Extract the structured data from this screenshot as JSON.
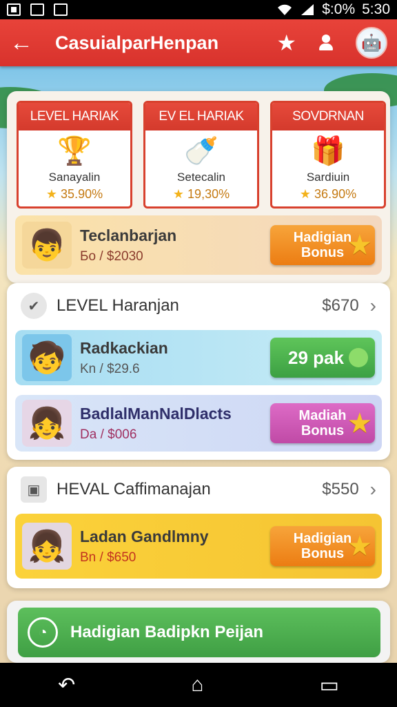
{
  "status": {
    "battery": "$:0%",
    "time": "5:30"
  },
  "appbar": {
    "title": "CasuialparHenpan"
  },
  "levels": [
    {
      "header": "LEVEL HARIAK",
      "name": "Sanayalin",
      "pct": "35.90%",
      "emoji": "🏆"
    },
    {
      "header": "EV EL HARIAK",
      "name": "Setecalin",
      "pct": "19,30%",
      "emoji": "🍼"
    },
    {
      "header": "SOVDRNAN",
      "name": "Sardiuin",
      "pct": "36.90%",
      "emoji": "🎁"
    }
  ],
  "featured": {
    "name": "Teclanbarjan",
    "sub": "Бo / $2030",
    "btn": [
      "Hadigian",
      "Bonus"
    ]
  },
  "section1": {
    "title": "LEVEL Haranjan",
    "price": "$670"
  },
  "rows1": [
    {
      "name": "Radkackian",
      "sub": "Kn / $29.6",
      "btn": "29 pak"
    },
    {
      "name": "BadlalManNalDlacts",
      "sub": "Da / $006",
      "btn": [
        "Madiah",
        "Bonus"
      ]
    }
  ],
  "section2": {
    "title": "HEVAL Caffimanajan",
    "price": "$550"
  },
  "rows2": [
    {
      "name": "Ladan Gandlmny",
      "sub": "Bn / $650",
      "btn": [
        "Hadigian",
        "Bonus"
      ]
    }
  ],
  "cta": {
    "label": "Hadigian Badipkn Peijan"
  },
  "colors": {
    "accent": "#d8322c",
    "green": "#3ca043",
    "orange": "#ec7d13",
    "pink": "#c04aa6"
  }
}
